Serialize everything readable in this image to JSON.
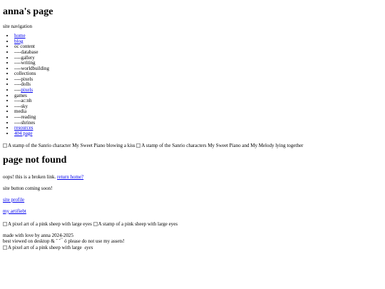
{
  "site": {
    "title": "anna's page"
  },
  "nav": {
    "heading": "site navigation",
    "items": [
      {
        "label": "home",
        "link": true
      },
      {
        "label": "blog",
        "link": true
      },
      {
        "label": "oc content",
        "link": false
      },
      {
        "label": "----database",
        "link": false
      },
      {
        "label": "----gallery",
        "link": false
      },
      {
        "label": "----writing",
        "link": false
      },
      {
        "label": "----worldbuilding",
        "link": false
      },
      {
        "label": "collections",
        "link": false
      },
      {
        "label": "----pixels",
        "link": false
      },
      {
        "label": "----dolls",
        "link": false
      },
      {
        "prefix": "----",
        "label": "pixels",
        "link": true
      },
      {
        "label": "games",
        "link": false
      },
      {
        "label": "----ac:nh",
        "link": false
      },
      {
        "label": "----sky",
        "link": false
      },
      {
        "label": "media",
        "link": false
      },
      {
        "label": "----reading",
        "link": false
      },
      {
        "label": "----shrines",
        "link": false
      },
      {
        "label": "resources",
        "link": true
      },
      {
        "label": "404 page",
        "link": true
      }
    ]
  },
  "stamps": {
    "stamp1_alt": "A stamp of the Sanrio character My Sweet Piano blowing a kiss",
    "stamp2_alt": "A stamp of the Sanrio characters My Sweet Piano and My Melody lying together"
  },
  "main": {
    "heading": "page not found",
    "message": "oops! this is a broken link.",
    "return_link": "return home?",
    "site_button_text": "site button coming soon!",
    "site_profile_link": "site profile",
    "artifact_link": "my artifiebt"
  },
  "footer": {
    "img1_alt": "A pixel art of a pink sheep with large eyes",
    "img2_alt": "A stamp of a pink sheep with large eyes",
    "made_with": "made with love by anna 2024-2025",
    "desktop_text": "best viewed on desktop & ˘ ˘ ̀ ̀ ó please do not use my assets!",
    "img3_alt_prefix": "A pixel art of a pink sheep with large",
    "img3_alt_italic": "eyes"
  }
}
